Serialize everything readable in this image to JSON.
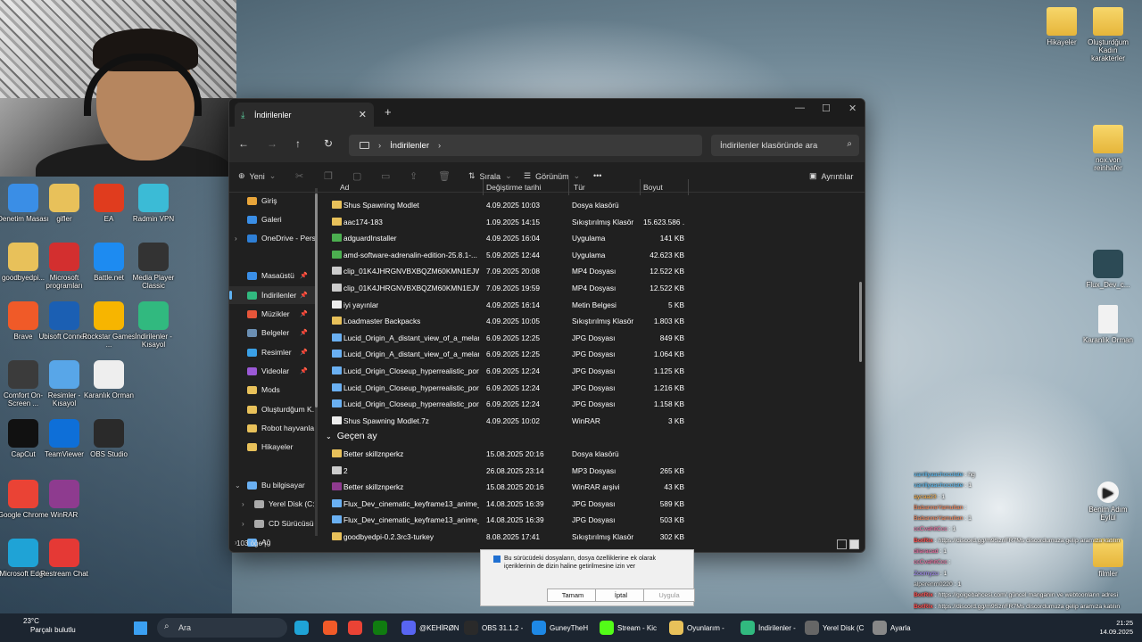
{
  "desktop_right_icons": [
    {
      "label": "Hikayeler"
    },
    {
      "label": "Oluşturdğum Kadın karakterler"
    },
    {
      "label": "nox.von reinhafer"
    },
    {
      "label": "Flux_Dev_c..."
    },
    {
      "label": "Karanlık Orman"
    },
    {
      "label": "Benim Adım Eylül"
    },
    {
      "label": "filmler"
    }
  ],
  "desktop_left_icons": [
    {
      "label": "Denetim Masası",
      "color": "#3a8ee6"
    },
    {
      "label": "gifler",
      "color": "#e8c15a"
    },
    {
      "label": "EA",
      "color": "#e03c1e"
    },
    {
      "label": "Radmin VPN",
      "color": "#3bbbd6"
    },
    {
      "label": "goodbyedpi...",
      "color": "#e8c15a"
    },
    {
      "label": "Microsoft programları",
      "color": "#d32f2f"
    },
    {
      "label": "Battle.net",
      "color": "#1d8bf1"
    },
    {
      "label": "Media Player Classic",
      "color": "#333333"
    },
    {
      "label": "Brave",
      "color": "#f05a28"
    },
    {
      "label": "Ubisoft Connect",
      "color": "#1b5fb3"
    },
    {
      "label": "Rockstar Games ...",
      "color": "#f7b500"
    },
    {
      "label": "İndirilenler - Kısayol",
      "color": "#31b97f"
    },
    {
      "label": "Comfort On-Screen ...",
      "color": "#3b3b3b"
    },
    {
      "label": "Resimler - Kısayol",
      "color": "#58a6e8"
    },
    {
      "label": "Karanlık Orman",
      "color": "#eeeeee"
    },
    {
      "label": "CapCut",
      "color": "#111111"
    },
    {
      "label": "TeamViewer",
      "color": "#0e6fd8"
    },
    {
      "label": "OBS Studio",
      "color": "#2a2a2a"
    },
    {
      "label": "Google Chrome",
      "color": "#ea4335"
    },
    {
      "label": "WinRAR",
      "color": "#8e3b8f"
    },
    {
      "label": "Microsoft Edge",
      "color": "#1fa3d6"
    },
    {
      "label": "Restream Chat",
      "color": "#e53935"
    }
  ],
  "explorer": {
    "tab_title": "İndirilenler",
    "new_tab": "+",
    "address": "İndirilenler",
    "search_placeholder": "İndirilenler klasöründe ara",
    "toolbar": {
      "new": "Yeni",
      "sort": "Sırala",
      "view": "Görünüm",
      "more": "•••",
      "details": "Ayrıntılar"
    },
    "columns": {
      "name": "Ad",
      "date": "Değiştirme tarihi",
      "type": "Tür",
      "size": "Boyut"
    },
    "sidebar": [
      {
        "label": "Giriş",
        "color": "#e8a53a"
      },
      {
        "label": "Galeri",
        "color": "#3a8ee6"
      },
      {
        "label": "OneDrive - Pers",
        "color": "#2e7fd6"
      },
      {
        "label": "Masaüstü",
        "color": "#3a8ee6"
      },
      {
        "label": "İndirilenler",
        "color": "#31b97f"
      },
      {
        "label": "Müzikler",
        "color": "#e6553a"
      },
      {
        "label": "Belgeler",
        "color": "#6b8fb3"
      },
      {
        "label": "Resimler",
        "color": "#3aa0e6"
      },
      {
        "label": "Videolar",
        "color": "#9b59d6"
      },
      {
        "label": "Mods",
        "color": "#e8c15a"
      },
      {
        "label": "Oluşturdğum K.",
        "color": "#e8c15a"
      },
      {
        "label": "Robot hayvanla",
        "color": "#e8c15a"
      },
      {
        "label": "Hikayeler",
        "color": "#e8c15a"
      },
      {
        "label": "Bu bilgisayar",
        "color": "#6ab0f2"
      },
      {
        "label": "Yerel Disk (C:)",
        "color": "#aaaaaa"
      },
      {
        "label": "CD Sürücüsü (",
        "color": "#aaaaaa"
      },
      {
        "label": "Ağ",
        "color": "#6ab0f2"
      }
    ],
    "files_top": [
      {
        "name": "Shus Spawning Modlet",
        "date": "4.09.2025 10:03",
        "type": "Dosya klasörü",
        "size": "",
        "icon": "folder"
      },
      {
        "name": "aac174-183",
        "date": "1.09.2025 14:15",
        "type": "Sıkıştırılmış Klasör",
        "size": "15.623.586 ...",
        "icon": "zip"
      },
      {
        "name": "adguardInstaller",
        "date": "4.09.2025 16:04",
        "type": "Uygulama",
        "size": "141 KB",
        "icon": "app"
      },
      {
        "name": "amd-software-adrenalin-edition-25.8.1-...",
        "date": "5.09.2025 12:44",
        "type": "Uygulama",
        "size": "42.623 KB",
        "icon": "app"
      },
      {
        "name": "clip_01K4JHRGNVBXBQZM60KMN1EJWN...",
        "date": "7.09.2025 20:08",
        "type": "MP4 Dosyası",
        "size": "12.522 KB",
        "icon": "video"
      },
      {
        "name": "clip_01K4JHRGNVBXBQZM60KMN1EJWN",
        "date": "7.09.2025 19:59",
        "type": "MP4 Dosyası",
        "size": "12.522 KB",
        "icon": "video"
      },
      {
        "name": "iyi yayınlar",
        "date": "4.09.2025 16:14",
        "type": "Metin Belgesi",
        "size": "5 KB",
        "icon": "text"
      },
      {
        "name": "Loadmaster Backpacks",
        "date": "4.09.2025 10:05",
        "type": "Sıkıştırılmış Klasör",
        "size": "1.803 KB",
        "icon": "zip"
      },
      {
        "name": "Lucid_Origin_A_distant_view_of_a_melan...",
        "date": "6.09.2025 12:25",
        "type": "JPG Dosyası",
        "size": "849 KB",
        "icon": "image"
      },
      {
        "name": "Lucid_Origin_A_distant_view_of_a_melan...",
        "date": "6.09.2025 12:25",
        "type": "JPG Dosyası",
        "size": "1.064 KB",
        "icon": "image"
      },
      {
        "name": "Lucid_Origin_Closeup_hyperrealistic_port...",
        "date": "6.09.2025 12:24",
        "type": "JPG Dosyası",
        "size": "1.125 KB",
        "icon": "image"
      },
      {
        "name": "Lucid_Origin_Closeup_hyperrealistic_port...",
        "date": "6.09.2025 12:24",
        "type": "JPG Dosyası",
        "size": "1.216 KB",
        "icon": "image"
      },
      {
        "name": "Lucid_Origin_Closeup_hyperrealistic_port...",
        "date": "6.09.2025 12:24",
        "type": "JPG Dosyası",
        "size": "1.158 KB",
        "icon": "image"
      },
      {
        "name": "Shus Spawning Modlet.7z",
        "date": "4.09.2025 10:02",
        "type": "WinRAR",
        "size": "3 KB",
        "icon": "text"
      }
    ],
    "group_label": "Geçen ay",
    "files_group": [
      {
        "name": "Better skillznperkz",
        "date": "15.08.2025 20:16",
        "type": "Dosya klasörü",
        "size": "",
        "icon": "folder"
      },
      {
        "name": "2",
        "date": "26.08.2025 23:14",
        "type": "MP3 Dosyası",
        "size": "265 KB",
        "icon": "audio"
      },
      {
        "name": "Better skillznperkz",
        "date": "15.08.2025 20:16",
        "type": "WinRAR arşivi",
        "size": "43 KB",
        "icon": "rar"
      },
      {
        "name": "Flux_Dev_cinematic_keyframe13_anime_...",
        "date": "14.08.2025 16:39",
        "type": "JPG Dosyası",
        "size": "589 KB",
        "icon": "image"
      },
      {
        "name": "Flux_Dev_cinematic_keyframe13_anime_...",
        "date": "14.08.2025 16:39",
        "type": "JPG Dosyası",
        "size": "503 KB",
        "icon": "image"
      },
      {
        "name": "goodbyedpi-0.2.3rc3-turkey",
        "date": "8.08.2025 17:41",
        "type": "Sıkıştırılmış Klasör",
        "size": "302 KB",
        "icon": "zip"
      }
    ],
    "status": "103 öğe  |"
  },
  "dialog": {
    "text": "Bu sürücüdeki dosyaların, dosya özelliklerine ek olarak içeriklerinin de dizin haline getirilmesine izin ver",
    "ok": "Tamam",
    "cancel": "İptal",
    "apply": "Uygula"
  },
  "chat": [
    {
      "user": "vanillyaachocolate",
      "msg": ": hg",
      "cls": "u1"
    },
    {
      "user": "vanillyaachocolate",
      "msg": ": 1",
      "cls": "u1"
    },
    {
      "user": "aycaa23",
      "msg": ": 1",
      "cls": "u2"
    },
    {
      "user": "BabanneYamultan",
      "msg": ":",
      "cls": "u4"
    },
    {
      "user": "BabanneYamultan",
      "msg": ": 1",
      "cls": "u4"
    },
    {
      "user": "ccCvahitCcc",
      "msg": ": 1",
      "cls": "u3"
    },
    {
      "user": "BotRix",
      "msg": ": https://discord.gg/m9SznFR7Ms discordumuza gelip aramıza katılın",
      "cls": "ub"
    },
    {
      "user": "dilaracad",
      "msg": ": 1",
      "cls": "u3"
    },
    {
      "user": "ccCvahitCcc",
      "msg": ":",
      "cls": "u3"
    },
    {
      "user": "Zoomyzu",
      "msg": ": 1",
      "cls": "u5"
    },
    {
      "user": "alperenrn0220",
      "msg": ": 1",
      "cls": "u6"
    },
    {
      "user": "BotRix",
      "msg": ": https://golgebahcesi.com/ güncel manganın ve webtoonların adresi",
      "cls": "ub"
    },
    {
      "user": "BotRix",
      "msg": ": https://discord.gg/m9SznFR7Ms discordumuza gelip aramıza katılın",
      "cls": "ub"
    }
  ],
  "taskbar": {
    "weather_temp": "23°C",
    "weather_desc": "Parçalı bulutlu",
    "search": "Ara",
    "items": [
      {
        "label": "@KEHİRØN"
      },
      {
        "label": "OBS 31.1.2 -"
      },
      {
        "label": "GuneyTheH"
      },
      {
        "label": "Stream - Kic"
      },
      {
        "label": "Oyunlarım -"
      },
      {
        "label": "İndirilenler -"
      },
      {
        "label": "Yerel Disk (C"
      },
      {
        "label": "Ayarla"
      }
    ],
    "time": "21:25",
    "date": "14.09.2025"
  }
}
